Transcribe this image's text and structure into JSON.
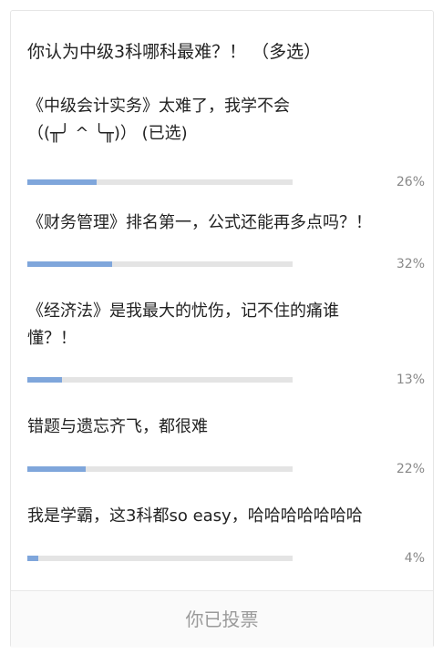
{
  "poll": {
    "question": "你认为中级3科哪科最难？！ （多选）",
    "options": [
      {
        "lines": [
          "《中级会计实务》太难了，我学不会",
          "（(╥╯ ^ ╰╥)）  (已选)"
        ],
        "percent_label": "26%",
        "percent": 26
      },
      {
        "lines": [
          "《财务管理》排名第一，公式还能再多点吗？！"
        ],
        "percent_label": "32%",
        "percent": 32
      },
      {
        "lines": [
          "《经济法》是我最大的忧伤，记不住的痛谁",
          "懂？！"
        ],
        "percent_label": "13%",
        "percent": 13
      },
      {
        "lines": [
          "错题与遗忘齐飞，都很难"
        ],
        "percent_label": "22%",
        "percent": 22
      },
      {
        "lines": [
          "我是学霸，这3科都so easy，哈哈哈哈哈哈哈"
        ],
        "percent_label": "4%",
        "percent": 4
      }
    ],
    "footer_label": "你已投票"
  },
  "colors": {
    "bar_fill": "#7fa6db",
    "bar_track": "#e4e4e4",
    "percent_text": "#888888",
    "footer_text": "#9a9a9a"
  }
}
